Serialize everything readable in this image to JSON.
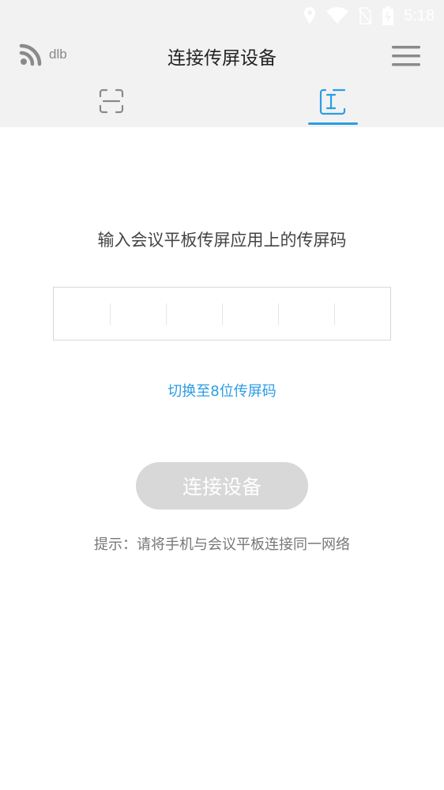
{
  "status_bar": {
    "time": "5:18"
  },
  "app_bar": {
    "wifi_name": "dlb",
    "title": "连接传屏设备"
  },
  "tabs": [
    {
      "icon": "scan-icon",
      "selected": false
    },
    {
      "icon": "code-input-icon",
      "selected": true
    }
  ],
  "main": {
    "instruction": "输入会议平板传屏应用上的传屏码",
    "code_cells": [
      "",
      "",
      "",
      "",
      "",
      ""
    ],
    "switch_link": "切换至8位传屏码",
    "connect_button": "连接设备",
    "hint": "提示：请将手机与会议平板连接同一网络"
  },
  "colors": {
    "accent": "#2a9de4",
    "header_bg": "#f2f2f2",
    "button_disabled": "#d8d8d8"
  }
}
